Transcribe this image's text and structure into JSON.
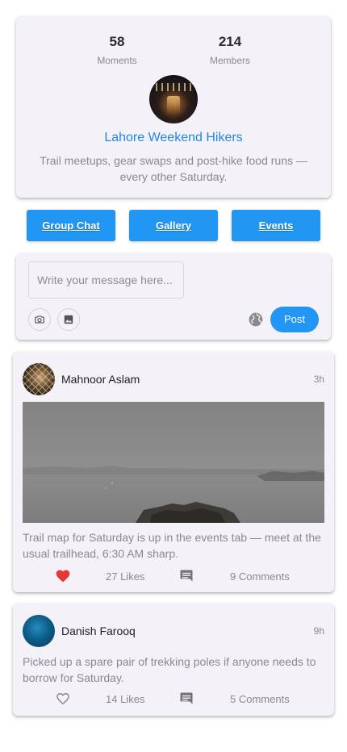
{
  "group": {
    "moments_count": "58",
    "moments_label": "Moments",
    "members_count": "214",
    "members_label": "Members",
    "name": "Lahore Weekend Hikers",
    "description": "Trail meetups, gear swaps and post-hike food runs — every other Saturday."
  },
  "nav": {
    "group_chat": "Group Chat",
    "gallery": "Gallery",
    "events": "Events"
  },
  "composer": {
    "placeholder": "Write your message here...",
    "value": "",
    "post_label": "Post",
    "camera_icon": "camera-icon",
    "image_icon": "image-icon",
    "visibility_icon": "globe-icon"
  },
  "posts": [
    {
      "author": "Mahnoor Aslam",
      "time": "3h",
      "text": "Trail map for Saturday is up in the events tab — meet at the usual trailhead, 6:30 AM sharp.",
      "likes": "27 Likes",
      "comments": "9 Comments",
      "liked": true
    },
    {
      "author": "Danish Farooq",
      "time": "9h",
      "text": "Picked up a spare pair of trekking poles if anyone needs to borrow for Saturday.",
      "likes": "14 Likes",
      "comments": "5 Comments",
      "liked": false
    }
  ],
  "colors": {
    "accent": "#2196f3",
    "group_name": "#1e88e5",
    "liked_heart": "#e53935",
    "card_bg": "#f5f1f8"
  }
}
